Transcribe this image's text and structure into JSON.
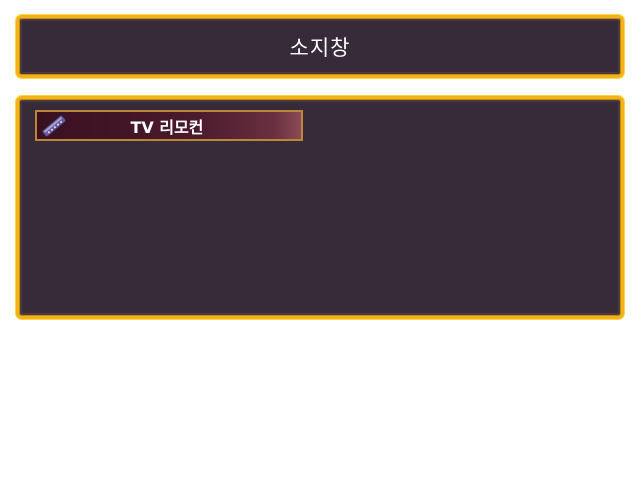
{
  "header": {
    "title": "소지창"
  },
  "inventory": {
    "items": [
      {
        "label": "TV 리모컨",
        "icon": "tv-remote-icon"
      }
    ]
  },
  "colors": {
    "panel_background": "#372b3a",
    "panel_border": "#f2b21a",
    "slot_border": "#b8873a",
    "slot_background": "#4a1a2c",
    "text": "#ffffff"
  }
}
